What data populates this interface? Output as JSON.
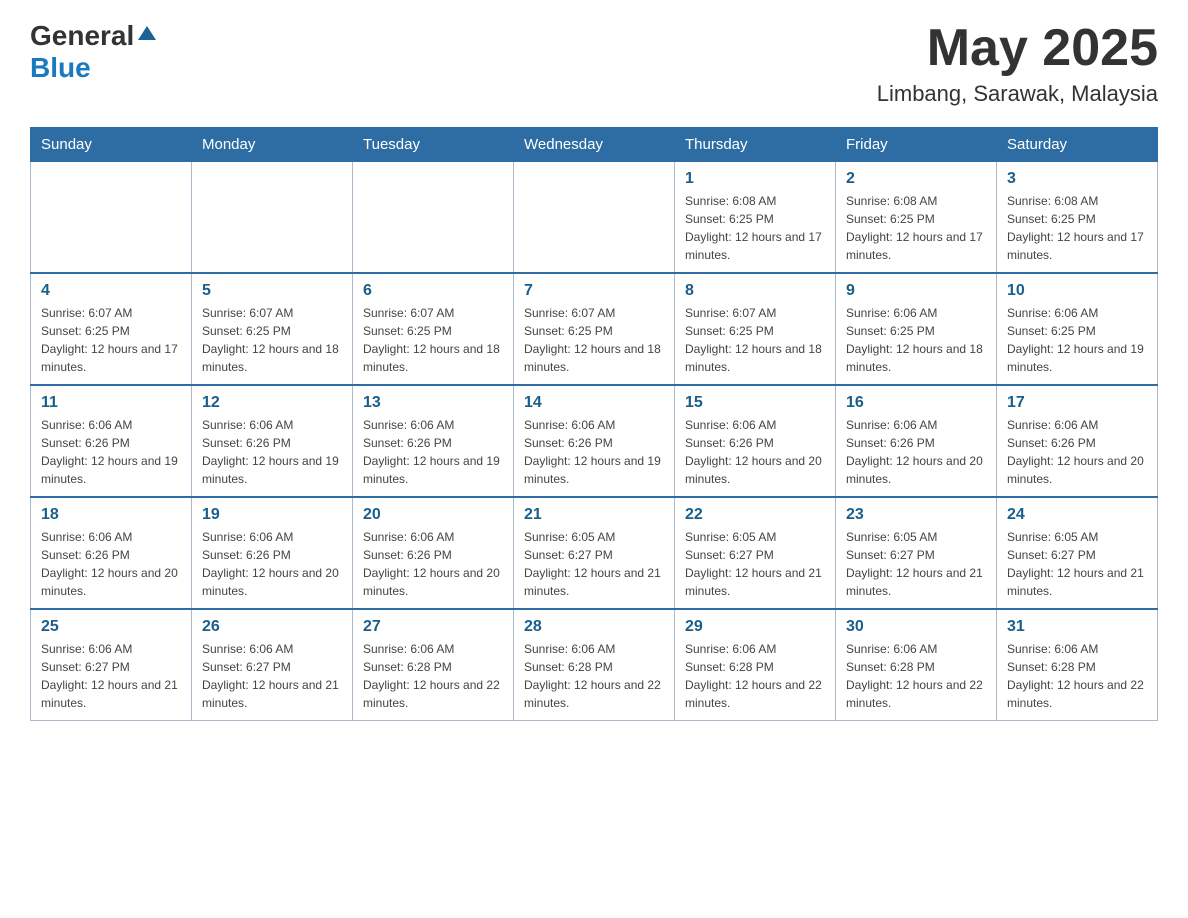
{
  "header": {
    "logo": {
      "general": "General",
      "arrow_symbol": "▲",
      "blue": "Blue"
    },
    "month": "May 2025",
    "location": "Limbang, Sarawak, Malaysia"
  },
  "weekdays": [
    "Sunday",
    "Monday",
    "Tuesday",
    "Wednesday",
    "Thursday",
    "Friday",
    "Saturday"
  ],
  "weeks": [
    [
      {
        "day": "",
        "sunrise": "",
        "sunset": "",
        "daylight": ""
      },
      {
        "day": "",
        "sunrise": "",
        "sunset": "",
        "daylight": ""
      },
      {
        "day": "",
        "sunrise": "",
        "sunset": "",
        "daylight": ""
      },
      {
        "day": "",
        "sunrise": "",
        "sunset": "",
        "daylight": ""
      },
      {
        "day": "1",
        "sunrise": "Sunrise: 6:08 AM",
        "sunset": "Sunset: 6:25 PM",
        "daylight": "Daylight: 12 hours and 17 minutes."
      },
      {
        "day": "2",
        "sunrise": "Sunrise: 6:08 AM",
        "sunset": "Sunset: 6:25 PM",
        "daylight": "Daylight: 12 hours and 17 minutes."
      },
      {
        "day": "3",
        "sunrise": "Sunrise: 6:08 AM",
        "sunset": "Sunset: 6:25 PM",
        "daylight": "Daylight: 12 hours and 17 minutes."
      }
    ],
    [
      {
        "day": "4",
        "sunrise": "Sunrise: 6:07 AM",
        "sunset": "Sunset: 6:25 PM",
        "daylight": "Daylight: 12 hours and 17 minutes."
      },
      {
        "day": "5",
        "sunrise": "Sunrise: 6:07 AM",
        "sunset": "Sunset: 6:25 PM",
        "daylight": "Daylight: 12 hours and 18 minutes."
      },
      {
        "day": "6",
        "sunrise": "Sunrise: 6:07 AM",
        "sunset": "Sunset: 6:25 PM",
        "daylight": "Daylight: 12 hours and 18 minutes."
      },
      {
        "day": "7",
        "sunrise": "Sunrise: 6:07 AM",
        "sunset": "Sunset: 6:25 PM",
        "daylight": "Daylight: 12 hours and 18 minutes."
      },
      {
        "day": "8",
        "sunrise": "Sunrise: 6:07 AM",
        "sunset": "Sunset: 6:25 PM",
        "daylight": "Daylight: 12 hours and 18 minutes."
      },
      {
        "day": "9",
        "sunrise": "Sunrise: 6:06 AM",
        "sunset": "Sunset: 6:25 PM",
        "daylight": "Daylight: 12 hours and 18 minutes."
      },
      {
        "day": "10",
        "sunrise": "Sunrise: 6:06 AM",
        "sunset": "Sunset: 6:25 PM",
        "daylight": "Daylight: 12 hours and 19 minutes."
      }
    ],
    [
      {
        "day": "11",
        "sunrise": "Sunrise: 6:06 AM",
        "sunset": "Sunset: 6:26 PM",
        "daylight": "Daylight: 12 hours and 19 minutes."
      },
      {
        "day": "12",
        "sunrise": "Sunrise: 6:06 AM",
        "sunset": "Sunset: 6:26 PM",
        "daylight": "Daylight: 12 hours and 19 minutes."
      },
      {
        "day": "13",
        "sunrise": "Sunrise: 6:06 AM",
        "sunset": "Sunset: 6:26 PM",
        "daylight": "Daylight: 12 hours and 19 minutes."
      },
      {
        "day": "14",
        "sunrise": "Sunrise: 6:06 AM",
        "sunset": "Sunset: 6:26 PM",
        "daylight": "Daylight: 12 hours and 19 minutes."
      },
      {
        "day": "15",
        "sunrise": "Sunrise: 6:06 AM",
        "sunset": "Sunset: 6:26 PM",
        "daylight": "Daylight: 12 hours and 20 minutes."
      },
      {
        "day": "16",
        "sunrise": "Sunrise: 6:06 AM",
        "sunset": "Sunset: 6:26 PM",
        "daylight": "Daylight: 12 hours and 20 minutes."
      },
      {
        "day": "17",
        "sunrise": "Sunrise: 6:06 AM",
        "sunset": "Sunset: 6:26 PM",
        "daylight": "Daylight: 12 hours and 20 minutes."
      }
    ],
    [
      {
        "day": "18",
        "sunrise": "Sunrise: 6:06 AM",
        "sunset": "Sunset: 6:26 PM",
        "daylight": "Daylight: 12 hours and 20 minutes."
      },
      {
        "day": "19",
        "sunrise": "Sunrise: 6:06 AM",
        "sunset": "Sunset: 6:26 PM",
        "daylight": "Daylight: 12 hours and 20 minutes."
      },
      {
        "day": "20",
        "sunrise": "Sunrise: 6:06 AM",
        "sunset": "Sunset: 6:26 PM",
        "daylight": "Daylight: 12 hours and 20 minutes."
      },
      {
        "day": "21",
        "sunrise": "Sunrise: 6:05 AM",
        "sunset": "Sunset: 6:27 PM",
        "daylight": "Daylight: 12 hours and 21 minutes."
      },
      {
        "day": "22",
        "sunrise": "Sunrise: 6:05 AM",
        "sunset": "Sunset: 6:27 PM",
        "daylight": "Daylight: 12 hours and 21 minutes."
      },
      {
        "day": "23",
        "sunrise": "Sunrise: 6:05 AM",
        "sunset": "Sunset: 6:27 PM",
        "daylight": "Daylight: 12 hours and 21 minutes."
      },
      {
        "day": "24",
        "sunrise": "Sunrise: 6:05 AM",
        "sunset": "Sunset: 6:27 PM",
        "daylight": "Daylight: 12 hours and 21 minutes."
      }
    ],
    [
      {
        "day": "25",
        "sunrise": "Sunrise: 6:06 AM",
        "sunset": "Sunset: 6:27 PM",
        "daylight": "Daylight: 12 hours and 21 minutes."
      },
      {
        "day": "26",
        "sunrise": "Sunrise: 6:06 AM",
        "sunset": "Sunset: 6:27 PM",
        "daylight": "Daylight: 12 hours and 21 minutes."
      },
      {
        "day": "27",
        "sunrise": "Sunrise: 6:06 AM",
        "sunset": "Sunset: 6:28 PM",
        "daylight": "Daylight: 12 hours and 22 minutes."
      },
      {
        "day": "28",
        "sunrise": "Sunrise: 6:06 AM",
        "sunset": "Sunset: 6:28 PM",
        "daylight": "Daylight: 12 hours and 22 minutes."
      },
      {
        "day": "29",
        "sunrise": "Sunrise: 6:06 AM",
        "sunset": "Sunset: 6:28 PM",
        "daylight": "Daylight: 12 hours and 22 minutes."
      },
      {
        "day": "30",
        "sunrise": "Sunrise: 6:06 AM",
        "sunset": "Sunset: 6:28 PM",
        "daylight": "Daylight: 12 hours and 22 minutes."
      },
      {
        "day": "31",
        "sunrise": "Sunrise: 6:06 AM",
        "sunset": "Sunset: 6:28 PM",
        "daylight": "Daylight: 12 hours and 22 minutes."
      }
    ]
  ]
}
